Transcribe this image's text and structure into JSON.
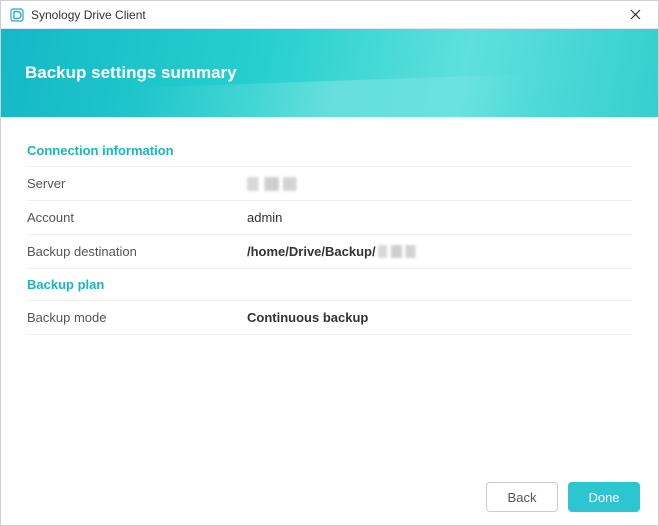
{
  "window": {
    "title": "Synology Drive Client"
  },
  "banner": {
    "title": "Backup settings summary"
  },
  "sections": {
    "connection": {
      "header": "Connection information",
      "server_label": "Server",
      "server_value_redacted": true,
      "account_label": "Account",
      "account_value": "admin",
      "dest_label": "Backup destination",
      "dest_value_prefix": "/home/Drive/Backup/",
      "dest_value_suffix_redacted": true
    },
    "plan": {
      "header": "Backup plan",
      "mode_label": "Backup mode",
      "mode_value": "Continuous backup"
    }
  },
  "buttons": {
    "back": "Back",
    "done": "Done"
  },
  "colors": {
    "accent": "#16b6c4",
    "primary_button": "#2dc5d2"
  }
}
